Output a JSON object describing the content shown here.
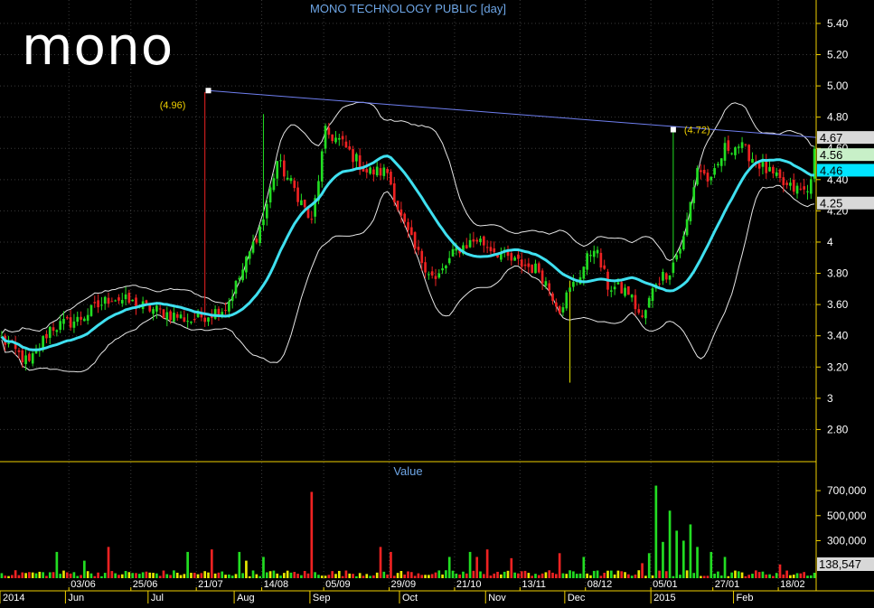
{
  "watermark": "mono",
  "chart_data": {
    "type": "candlestick",
    "title": "MONO TECHNOLOGY PUBLIC [day]",
    "price_axis": {
      "ticks": [
        2.8,
        3,
        3.2,
        3.4,
        3.6,
        3.8,
        4,
        4.2,
        4.4,
        4.6,
        4.8,
        5.0,
        5.2,
        5.4
      ],
      "tick_labels": [
        "2.80",
        "3",
        "3.20",
        "3.40",
        "3.60",
        "3.80",
        "4",
        "4.20",
        "4.40",
        "4.60",
        "4.80",
        "5.00",
        "5.20",
        "5.40"
      ],
      "ylim": [
        2.6,
        5.55
      ]
    },
    "value_axis": {
      "title": "Value",
      "ticks": [
        300000,
        500000,
        700000
      ],
      "tick_labels": [
        "300,000",
        "500,000",
        "700,000"
      ],
      "ylim": [
        0,
        780000
      ]
    },
    "price_markers": [
      {
        "label": "4.67",
        "value": 4.67,
        "color": "#d8d8d8",
        "text": "#000000"
      },
      {
        "label": "4.56",
        "value": 4.56,
        "color": "#c8f0c8",
        "text": "#000000"
      },
      {
        "label": "4.46",
        "value": 4.46,
        "color": "#00e5ff",
        "text": "#000000"
      },
      {
        "label": "4.25",
        "value": 4.25,
        "color": "#d8d8d8",
        "text": "#000000"
      }
    ],
    "volume_marker": {
      "label": "138,547",
      "value": 138547
    },
    "annotations": [
      {
        "label": "(4.96)",
        "date_index": 59,
        "value": 4.96
      },
      {
        "label": "(4.72)",
        "date_index": 195,
        "value": 4.72
      }
    ],
    "trendline": {
      "from": {
        "date_index": 60,
        "value": 4.97
      },
      "to": {
        "date_index": 236,
        "value": 4.67
      }
    },
    "x_axis": {
      "n_days": 237,
      "date_ticks": [
        {
          "label": "03/06",
          "date_index": 20
        },
        {
          "label": "25/06",
          "date_index": 38
        },
        {
          "label": "21/07",
          "date_index": 57
        },
        {
          "label": "14/08",
          "date_index": 76
        },
        {
          "label": "05/09",
          "date_index": 94
        },
        {
          "label": "29/09",
          "date_index": 113
        },
        {
          "label": "21/10",
          "date_index": 132
        },
        {
          "label": "13/11",
          "date_index": 151
        },
        {
          "label": "08/12",
          "date_index": 170
        },
        {
          "label": "05/01",
          "date_index": 189
        },
        {
          "label": "27/01",
          "date_index": 207
        },
        {
          "label": "18/02",
          "date_index": 226
        }
      ],
      "month_ticks": [
        {
          "label": "2014",
          "date_index": 0
        },
        {
          "label": "Jun",
          "date_index": 19
        },
        {
          "label": "Jul",
          "date_index": 43
        },
        {
          "label": "Aug",
          "date_index": 68
        },
        {
          "label": "Sep",
          "date_index": 90
        },
        {
          "label": "Oct",
          "date_index": 116
        },
        {
          "label": "Nov",
          "date_index": 141
        },
        {
          "label": "Dec",
          "date_index": 164
        },
        {
          "label": "2015",
          "date_index": 189
        },
        {
          "label": "Feb",
          "date_index": 213
        }
      ]
    },
    "price_anchors": [
      [
        0,
        3.38
      ],
      [
        8,
        3.22
      ],
      [
        14,
        3.45
      ],
      [
        22,
        3.5
      ],
      [
        32,
        3.65
      ],
      [
        42,
        3.58
      ],
      [
        55,
        3.5
      ],
      [
        65,
        3.58
      ],
      [
        70,
        3.82
      ],
      [
        76,
        4.15
      ],
      [
        80,
        4.52
      ],
      [
        86,
        4.3
      ],
      [
        90,
        4.12
      ],
      [
        94,
        4.7
      ],
      [
        98,
        4.65
      ],
      [
        106,
        4.45
      ],
      [
        112,
        4.45
      ],
      [
        116,
        4.15
      ],
      [
        120,
        3.95
      ],
      [
        126,
        3.75
      ],
      [
        132,
        3.95
      ],
      [
        138,
        4.02
      ],
      [
        148,
        3.88
      ],
      [
        156,
        3.82
      ],
      [
        162,
        3.58
      ],
      [
        168,
        3.8
      ],
      [
        172,
        3.98
      ],
      [
        176,
        3.72
      ],
      [
        182,
        3.68
      ],
      [
        186,
        3.5
      ],
      [
        190,
        3.75
      ],
      [
        194,
        3.82
      ],
      [
        198,
        4.02
      ],
      [
        202,
        4.48
      ],
      [
        206,
        4.38
      ],
      [
        210,
        4.6
      ],
      [
        214,
        4.62
      ],
      [
        220,
        4.5
      ],
      [
        224,
        4.42
      ],
      [
        228,
        4.35
      ],
      [
        234,
        4.32
      ],
      [
        236,
        4.56
      ]
    ],
    "volume_spikes": [
      [
        16,
        210000
      ],
      [
        24,
        140000
      ],
      [
        31,
        250000
      ],
      [
        54,
        210000
      ],
      [
        61,
        230000
      ],
      [
        69,
        210000
      ],
      [
        71,
        140000
      ],
      [
        76,
        170000
      ],
      [
        90,
        690000
      ],
      [
        110,
        250000
      ],
      [
        113,
        210000
      ],
      [
        130,
        170000
      ],
      [
        136,
        210000
      ],
      [
        138,
        170000
      ],
      [
        141,
        230000
      ],
      [
        148,
        160000
      ],
      [
        162,
        200000
      ],
      [
        169,
        170000
      ],
      [
        186,
        120000
      ],
      [
        188,
        200000
      ],
      [
        190,
        740000
      ],
      [
        192,
        290000
      ],
      [
        194,
        540000
      ],
      [
        196,
        380000
      ],
      [
        198,
        300000
      ],
      [
        200,
        430000
      ],
      [
        202,
        250000
      ],
      [
        206,
        210000
      ],
      [
        210,
        170000
      ],
      [
        226,
        110000
      ]
    ]
  }
}
